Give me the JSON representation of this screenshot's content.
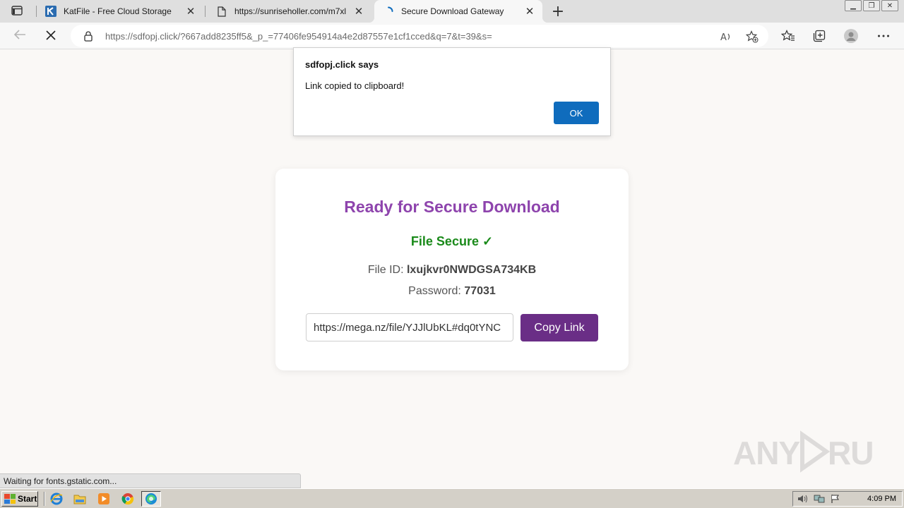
{
  "browser": {
    "tabs": [
      {
        "title": "KatFile - Free Cloud Storage",
        "favicon": "katfile-k-icon",
        "active": false
      },
      {
        "title": "https://sunriseholler.com/m7xl",
        "favicon": "page-icon",
        "active": false
      },
      {
        "title": "Secure Download Gateway",
        "favicon": "loading-spinner-icon",
        "active": true
      }
    ],
    "address": {
      "url_host": "https://sdfopj.click",
      "url_rest": "/?667add8235ff5&_p_=77406fe954914a4e2d87557e1cf1cced&q=7&t=39&s="
    }
  },
  "alert": {
    "title": "sdfopj.click says",
    "message": "Link copied to clipboard!",
    "ok_label": "OK"
  },
  "page": {
    "heading": "Ready for Secure Download",
    "status": "File Secure ✓",
    "file_id_label": "File ID:",
    "file_id": "lxujkvr0NWDGSA734KB",
    "password_label": "Password:",
    "password": "77031",
    "link_value": "https://mega.nz/file/YJJlUbKL#dq0tYNC",
    "copy_label": "Copy Link"
  },
  "statusbar": {
    "text": "Waiting for fonts.gstatic.com..."
  },
  "watermark": {
    "text": "ANY RUN"
  },
  "taskbar": {
    "start_label": "Start",
    "clock": "4:09 PM"
  },
  "colors": {
    "heading": "#8e44ad",
    "secure": "#1a8a1a",
    "copy_button": "#6a2e86",
    "ok_button": "#0f6cbd"
  }
}
